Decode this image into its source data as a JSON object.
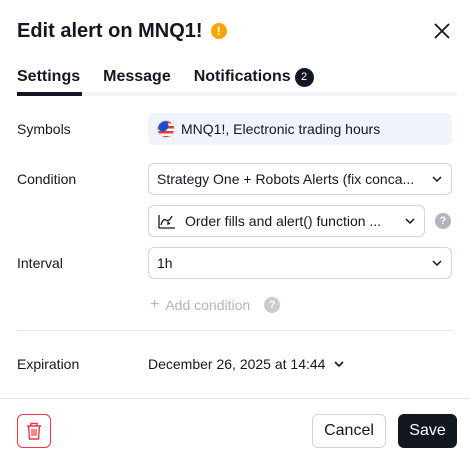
{
  "dialog": {
    "title": "Edit alert on MNQ1!",
    "warning_icon": "!"
  },
  "tabs": [
    {
      "label": "Settings",
      "active": true
    },
    {
      "label": "Message",
      "active": false
    },
    {
      "label": "Notifications",
      "active": false,
      "badge": "2"
    }
  ],
  "settings": {
    "symbols_label": "Symbols",
    "symbol_value": "MNQ1!, Electronic trading hours",
    "condition_label": "Condition",
    "condition_value": "Strategy One + Robots Alerts (fix conca...",
    "condition_sub_value": "Order fills and alert() function ...",
    "interval_label": "Interval",
    "interval_value": "1h",
    "add_condition_label": "Add condition",
    "add_condition_plus": "+",
    "help_glyph": "?",
    "expiration_label": "Expiration",
    "expiration_value": "December 26, 2025 at 14:44"
  },
  "footer": {
    "cancel_label": "Cancel",
    "save_label": "Save"
  },
  "colors": {
    "text": "#131722",
    "warning": "#f7a600",
    "danger": "#f23645",
    "muted": "#b2b5be",
    "border": "#d1d4dc"
  }
}
